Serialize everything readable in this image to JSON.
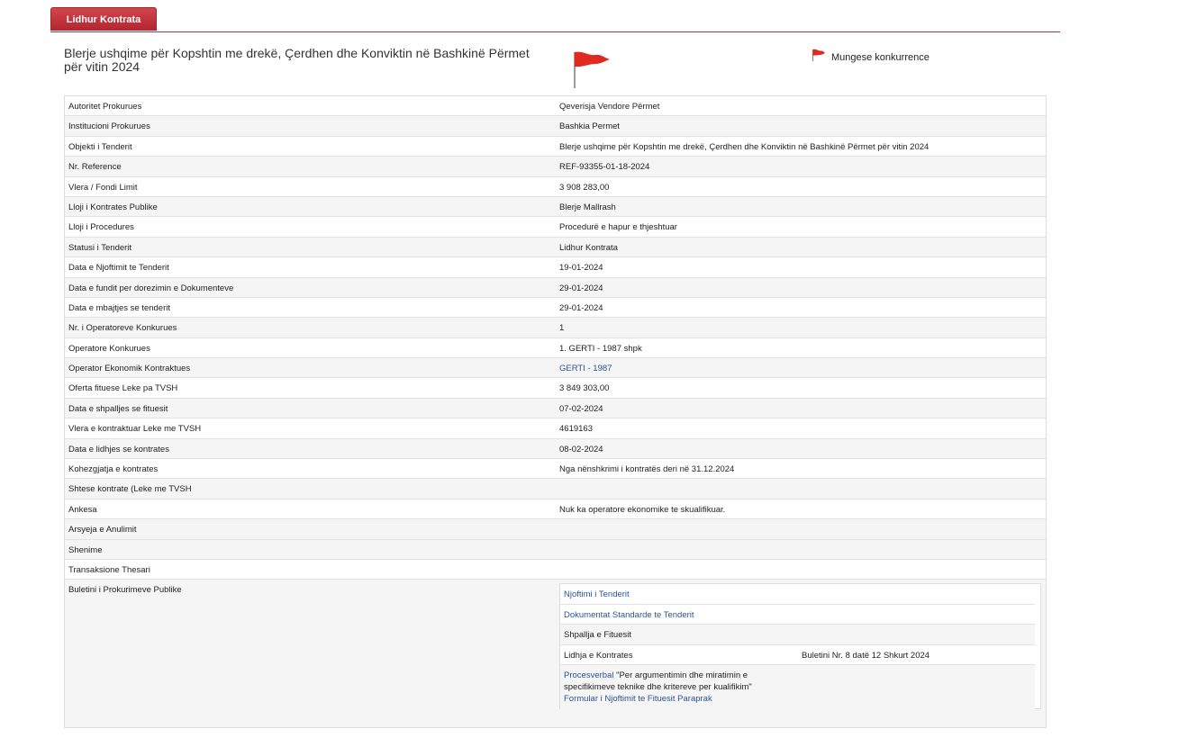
{
  "tab": {
    "label": "Lidhur Kontrata"
  },
  "header": {
    "title": "Blerje ushqime për Kopshtin me drekë, Çerdhen dhe Konviktin në Bashkinë Përmet për vitin 2024",
    "legend_label": "Mungese konkurrence",
    "flag_color": "#e02a1f"
  },
  "rows": [
    {
      "label": "Autoritet Prokurues",
      "value": "Qeverisja Vendore Përmet"
    },
    {
      "label": "Institucioni Prokurues",
      "value": "Bashkia Permet"
    },
    {
      "label": "Objekti i Tenderit",
      "value": "Blerje ushqime për Kopshtin me drekë, Çerdhen dhe Konviktin në Bashkinë Përmet për vitin 2024"
    },
    {
      "label": "Nr. Reference",
      "value": "REF-93355-01-18-2024"
    },
    {
      "label": "Vlera / Fondi Limit",
      "value": "3 908 283,00"
    },
    {
      "label": "Lloji i Kontrates Publike",
      "value": "Blerje Mallrash"
    },
    {
      "label": "Lloji i Procedures",
      "value": "Procedurë e hapur e thjeshtuar"
    },
    {
      "label": "Statusi i Tenderit",
      "value": "Lidhur Kontrata"
    },
    {
      "label": "Data e Njoftimit te Tenderit",
      "value": "19-01-2024"
    },
    {
      "label": "Data e fundit per dorezimin e Dokumenteve",
      "value": "29-01-2024"
    },
    {
      "label": "Data e mbajtjes se tenderit",
      "value": "29-01-2024"
    },
    {
      "label": "Nr. i Operatoreve Konkurues",
      "value": "1"
    },
    {
      "label": "Operatore Konkurues",
      "value": "1. GERTI - 1987 shpk"
    },
    {
      "label": "Operator Ekonomik Kontraktues",
      "value": "GERTI - 1987"
    },
    {
      "label": "Oferta fituese Leke pa TVSH",
      "value": "3 849 303,00"
    },
    {
      "label": "Data e shpalljes se fituesit",
      "value": "07-02-2024"
    },
    {
      "label": "Vlera e kontraktuar Leke me TVSH",
      "value": "4619163"
    },
    {
      "label": "Data e lidhjes se kontrates",
      "value": "08-02-2024"
    },
    {
      "label": "Kohezgjatja e kontrates",
      "value": "Nga nënshkrimi i kontratës deri në 31.12.2024"
    },
    {
      "label": "Shtese kontrate (Leke me TVSH",
      "value": ""
    },
    {
      "label": "Ankesa",
      "value": "Nuk ka operatore ekonomike te skualifikuar."
    },
    {
      "label": "Arsyeja e Anulimit",
      "value": ""
    },
    {
      "label": "Shenime",
      "value": ""
    },
    {
      "label": "Transaksione Thesari",
      "value": ""
    }
  ],
  "bulletin": {
    "label": "Buletini i Prokurimeve Publike",
    "notice_link": "Njoftimi i Tenderit",
    "standard_docs_link": "Dokumentat Standarde te Tenderit",
    "winner_announcement": "Shpallja e Fituesit",
    "contract_signing": "Lidhja e Kontrates",
    "contract_bulletin": "Buletini Nr. 8 datë 12 Shkurt 2024",
    "procesverbal_link": "Procesverbal",
    "procesverbal_text": "\"Per argumentimin dhe miratimin e specifikimeve teknike dhe kritereve per kualifikim\"",
    "winner_form_link": "Formular i Njoftimit te Fituesit Paraprak"
  }
}
